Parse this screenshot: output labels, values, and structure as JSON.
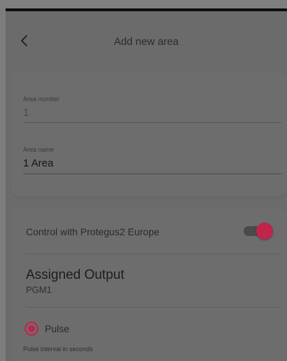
{
  "header": {
    "title": "Add new area",
    "back_icon": "chevron-left-icon"
  },
  "area_card": {
    "area_number_label": "Area number",
    "area_number_value": "1",
    "area_name_label": "Area name",
    "area_name_value": "1 Area"
  },
  "control_card": {
    "control_label": "Control with Protegus2 Europe",
    "control_enabled": true,
    "assigned_output_title": "Assigned Output",
    "assigned_output_value": "PGM1",
    "pulse_label": "Pulse",
    "pulse_selected": true,
    "pulse_interval_label": "Pulse interval in seconds"
  },
  "colors": {
    "accent": "#c0244a",
    "overlay_background": "#6b6b6b"
  }
}
